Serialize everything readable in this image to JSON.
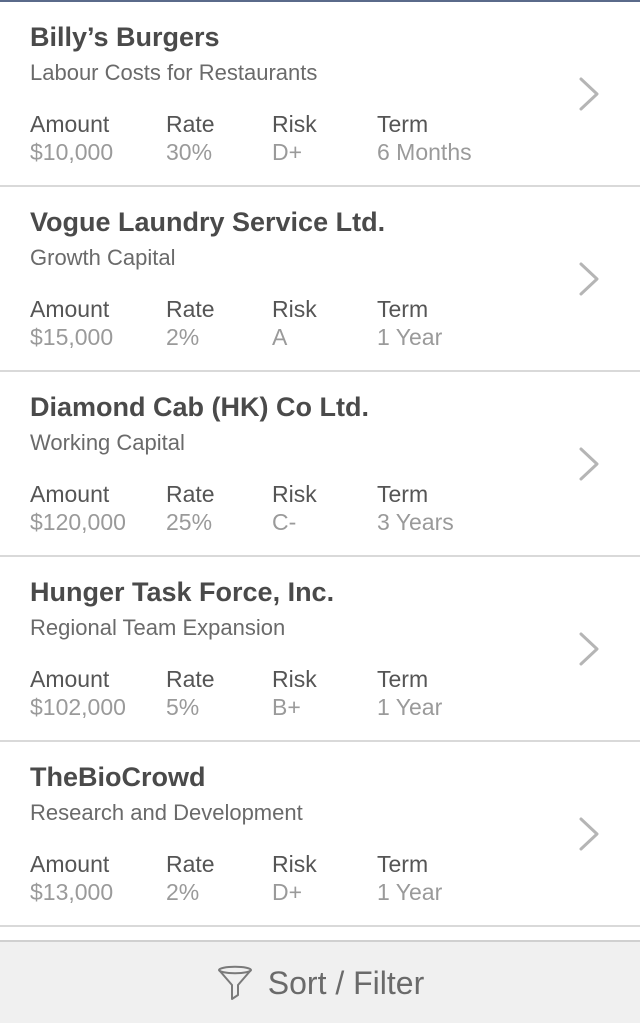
{
  "loans": [
    {
      "name": "Billy’s Burgers",
      "purpose": "Labour Costs for Restaurants",
      "amount": "$10,000",
      "rate": "30%",
      "risk": "D+",
      "term": "6 Months"
    },
    {
      "name": "Vogue Laundry Service Ltd.",
      "purpose": "Growth Capital",
      "amount": "$15,000",
      "rate": "2%",
      "risk": "A",
      "term": "1 Year"
    },
    {
      "name": "Diamond Cab (HK) Co Ltd.",
      "purpose": "Working Capital",
      "amount": "$120,000",
      "rate": "25%",
      "risk": "C-",
      "term": "3 Years"
    },
    {
      "name": "Hunger Task Force, Inc.",
      "purpose": "Regional Team Expansion",
      "amount": "$102,000",
      "rate": "5%",
      "risk": "B+",
      "term": "1 Year"
    },
    {
      "name": "TheBioCrowd",
      "purpose": "Research and Development",
      "amount": "$13,000",
      "rate": "2%",
      "risk": "D+",
      "term": "1 Year"
    }
  ],
  "labels": {
    "amount": "Amount",
    "rate": "Rate",
    "risk": "Risk",
    "term": "Term"
  },
  "footer": {
    "label": "Sort / Filter",
    "icon": "funnel-icon"
  },
  "colors": {
    "title": "#4a4a4a",
    "value": "#9a9a9a",
    "divider": "#d9d9d9",
    "footer_bg": "#f0f0f0"
  }
}
